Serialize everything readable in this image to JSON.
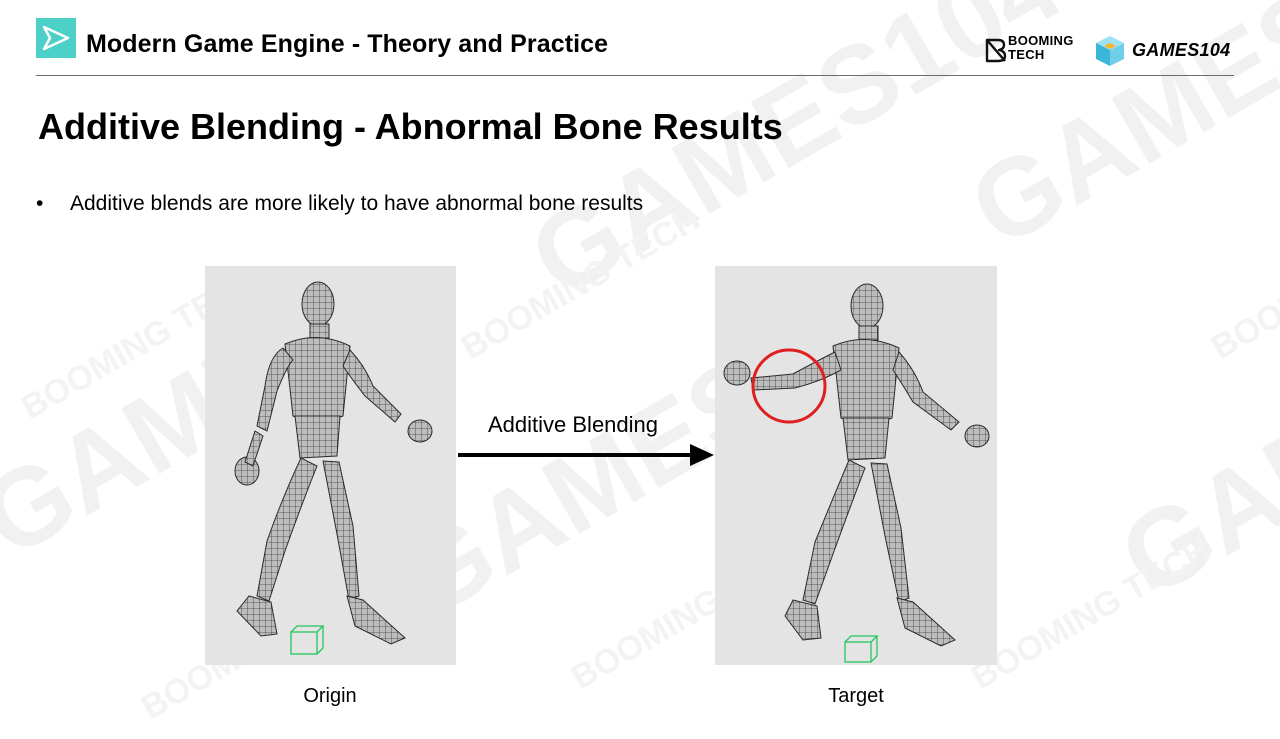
{
  "header": {
    "title": "Modern Game Engine - Theory and Practice",
    "brand_booming": "BOOMING",
    "brand_tech": "TECH",
    "brand_games": "GAMES104",
    "icons": [
      "play-logo-icon",
      "booming-b-icon",
      "games-cube-icon"
    ]
  },
  "slide": {
    "title": "Additive Blending - Abnormal Bone Results",
    "bullets": [
      "Additive blends are more likely to have abnormal bone results"
    ]
  },
  "figure": {
    "origin_caption": "Origin",
    "target_caption": "Target",
    "arrow_label": "Additive Blending",
    "highlight_color": "#e02020",
    "panel_color": "#e4e4e4"
  },
  "colors": {
    "accent": "#4dd0c8"
  }
}
